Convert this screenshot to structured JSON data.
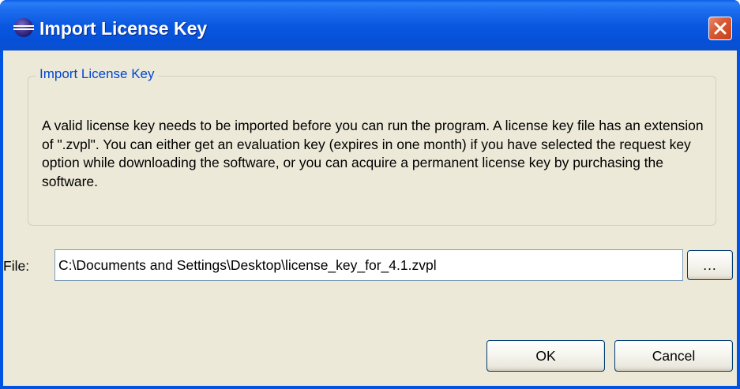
{
  "window": {
    "title": "Import License Key",
    "app_icon": "eclipse-icon",
    "close_icon": "close-icon"
  },
  "group": {
    "label": "Import License Key",
    "description": "A valid license key needs to be imported before you can run the program. A license key file has an extension of \".zvpl\". You can either get an evaluation key (expires in one month) if you have selected the request key option while downloading the software, or you can acquire a permanent license key by purchasing the software."
  },
  "file": {
    "label": "File:",
    "value": "C:\\Documents and Settings\\Desktop\\license_key_for_4.1.zvpl",
    "browse_label": "..."
  },
  "buttons": {
    "ok": "OK",
    "cancel": "Cancel"
  },
  "colors": {
    "titlebar": "#0a58e0",
    "dialog_background": "#ece9d8",
    "group_label": "#0046d5",
    "close_button": "#d85c34"
  }
}
